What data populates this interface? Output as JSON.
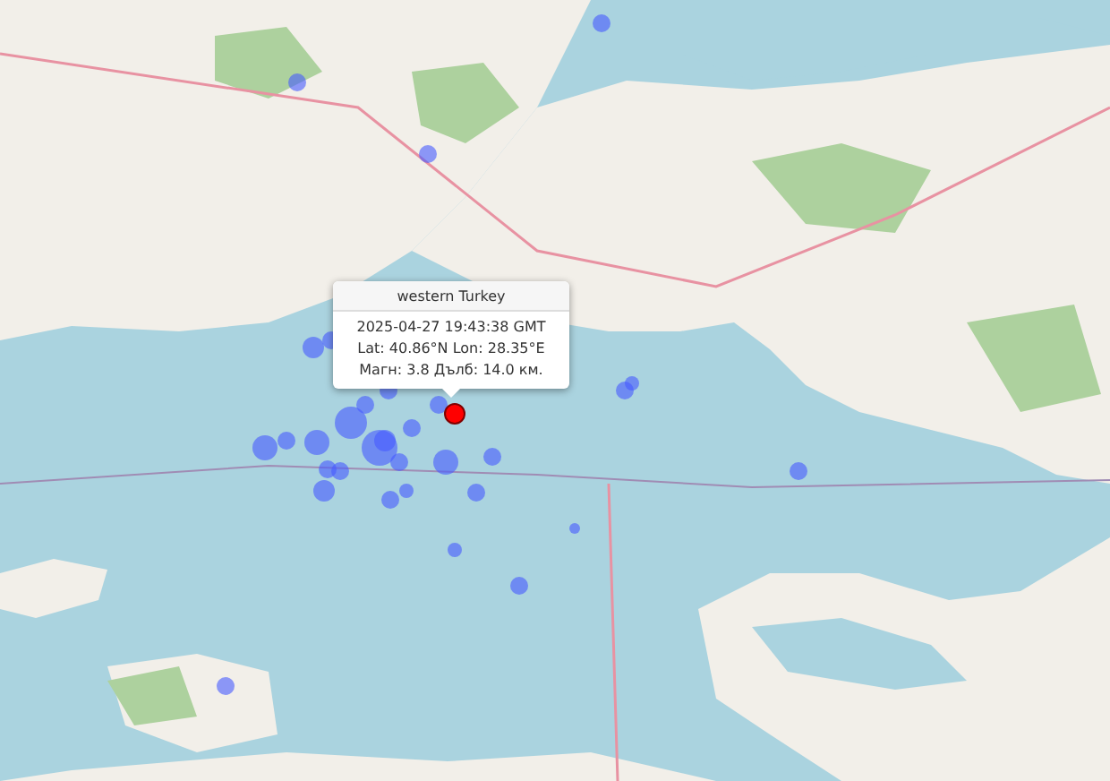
{
  "popup": {
    "title": "western Turkey",
    "lines": [
      "2025-04-27 19:43:38 GMT",
      "Lat: 40.86°N Lon: 28.35°E",
      "Магн: 3.8 Дълб: 14.0 км."
    ]
  },
  "markers": [
    {
      "selected": false
    },
    {
      "selected": false
    },
    {
      "selected": false
    },
    {
      "selected": false
    },
    {
      "selected": false
    },
    {
      "selected": false
    },
    {
      "selected": false
    },
    {
      "selected": false
    },
    {
      "selected": false
    },
    {
      "selected": false
    },
    {
      "selected": false
    },
    {
      "selected": false
    },
    {
      "selected": false
    },
    {
      "selected": false
    },
    {
      "selected": false
    },
    {
      "selected": false
    },
    {
      "selected": false
    },
    {
      "selected": false
    },
    {
      "selected": false
    },
    {
      "selected": false
    },
    {
      "selected": false
    },
    {
      "selected": false
    },
    {
      "selected": false
    },
    {
      "selected": false
    },
    {
      "selected": false
    },
    {
      "selected": false
    },
    {
      "selected": false
    },
    {
      "selected": false
    },
    {
      "selected": false
    },
    {
      "selected": false
    },
    {
      "selected": false
    },
    {
      "selected": true
    }
  ]
}
